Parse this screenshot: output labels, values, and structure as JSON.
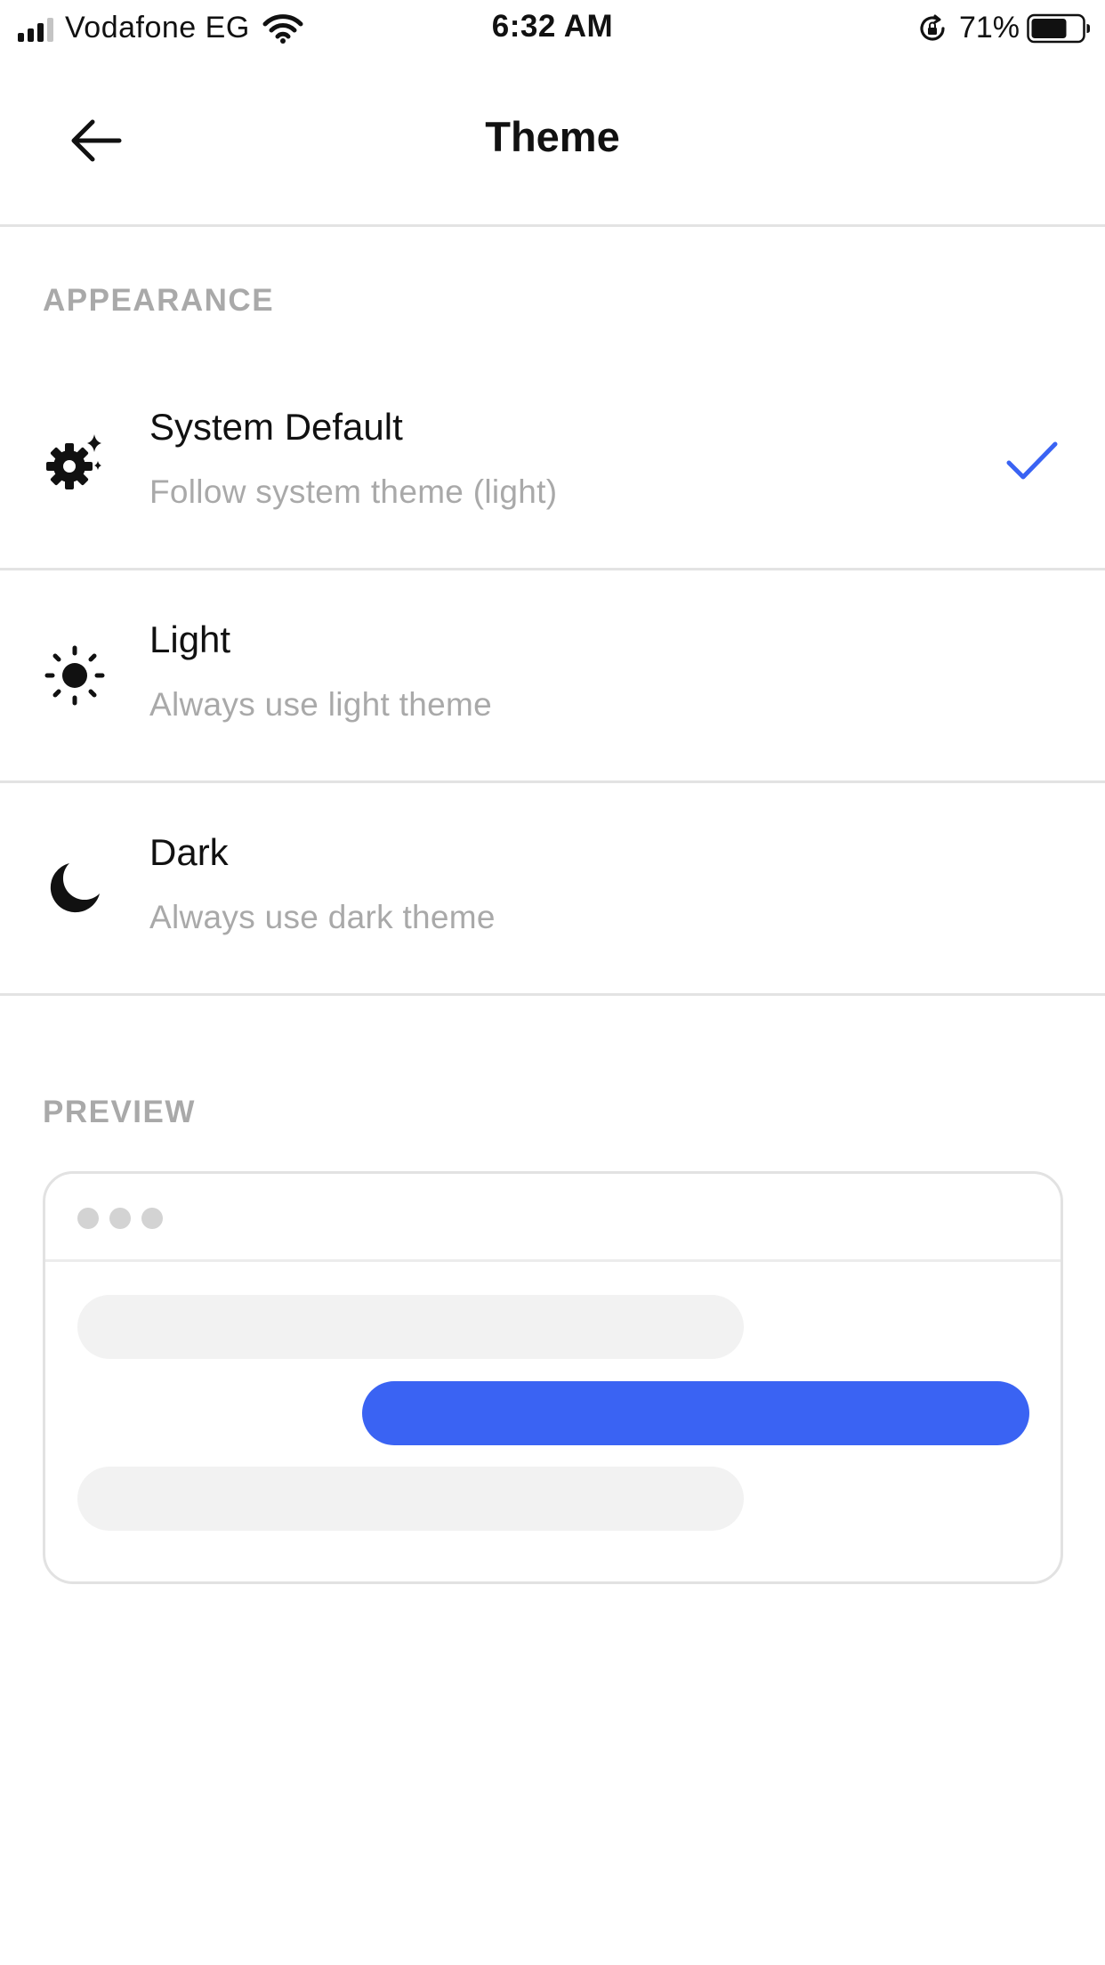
{
  "status_bar": {
    "carrier": "Vodafone EG",
    "time": "6:32 AM",
    "battery": "71%",
    "battery_level": 0.71
  },
  "nav": {
    "title": "Theme",
    "back_icon": "arrow-left-icon"
  },
  "appearance": {
    "section_title": "APPEARANCE",
    "options": [
      {
        "title": "System Default",
        "subtitle": "Follow system theme (light)",
        "icon": "gear-sparkle-icon",
        "selected": true
      },
      {
        "title": "Light",
        "subtitle": "Always use light theme",
        "icon": "sun-icon",
        "selected": false
      },
      {
        "title": "Dark",
        "subtitle": "Always use dark theme",
        "icon": "moon-icon",
        "selected": false
      }
    ]
  },
  "preview": {
    "section_title": "PREVIEW"
  },
  "colors": {
    "accent": "#3a63f3",
    "secondary_text": "#a9a9a9",
    "divider": "#e3e3e3",
    "bubble_gray": "#f2f2f2"
  }
}
